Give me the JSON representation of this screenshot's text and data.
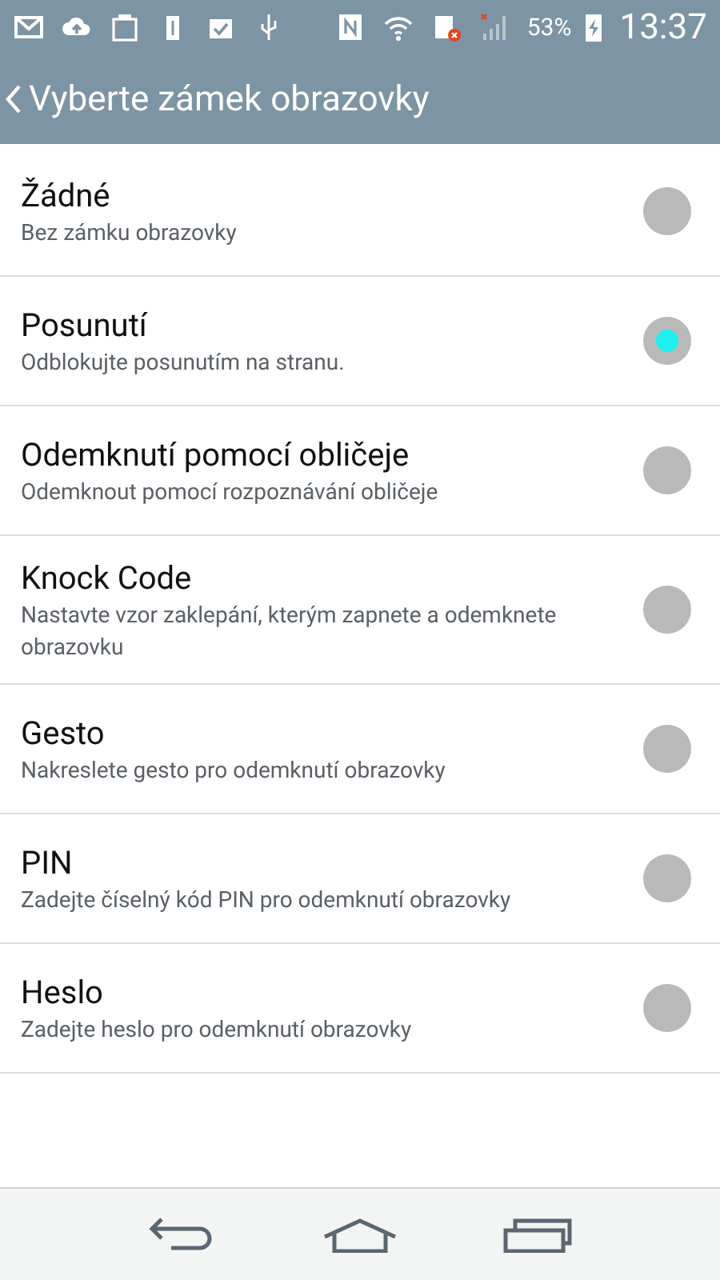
{
  "status_bar": {
    "battery": "53%",
    "time": "13:37"
  },
  "header": {
    "title": "Vyberte zámek obrazovky"
  },
  "options": [
    {
      "title": "Žádné",
      "subtitle": "Bez zámku obrazovky",
      "selected": false
    },
    {
      "title": "Posunutí",
      "subtitle": "Odblokujte posunutím na stranu.",
      "selected": true
    },
    {
      "title": "Odemknutí pomocí obličeje",
      "subtitle": "Odemknout pomocí rozpoznávání obličeje",
      "selected": false
    },
    {
      "title": "Knock Code",
      "subtitle": "Nastavte vzor zaklepání, kterým zapnete a odemknete obrazovku",
      "selected": false
    },
    {
      "title": "Gesto",
      "subtitle": "Nakreslete gesto pro odemknutí obrazovky",
      "selected": false
    },
    {
      "title": "PIN",
      "subtitle": "Zadejte číselný kód PIN pro odemknutí obrazovky",
      "selected": false
    },
    {
      "title": "Heslo",
      "subtitle": "Zadejte heslo pro odemknutí obrazovky",
      "selected": false
    }
  ]
}
